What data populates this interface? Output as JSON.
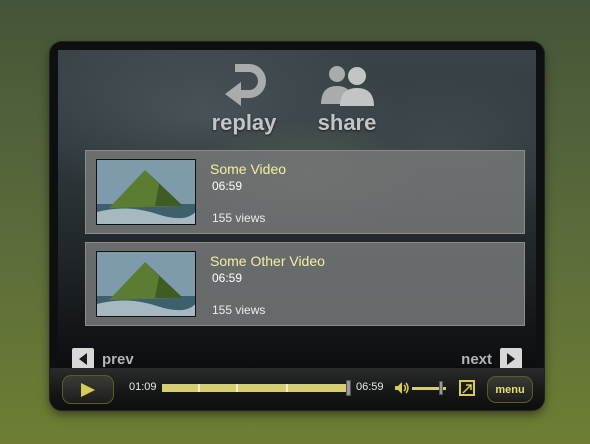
{
  "end_screen": {
    "replay_label": "replay",
    "share_label": "share"
  },
  "videos": [
    {
      "title": "Some Video",
      "duration": "06:59",
      "views": "155 views"
    },
    {
      "title": "Some Other Video",
      "duration": "06:59",
      "views": "155 views"
    }
  ],
  "navigation": {
    "prev_label": "prev",
    "next_label": "next"
  },
  "controls": {
    "current_time": "01:09",
    "duration": "06:59",
    "seek_progress": 0.99,
    "volume_level": 0.85,
    "menu_label": "menu"
  },
  "colors": {
    "accent": "#d6ce73",
    "title_text": "#f3f0a0"
  }
}
